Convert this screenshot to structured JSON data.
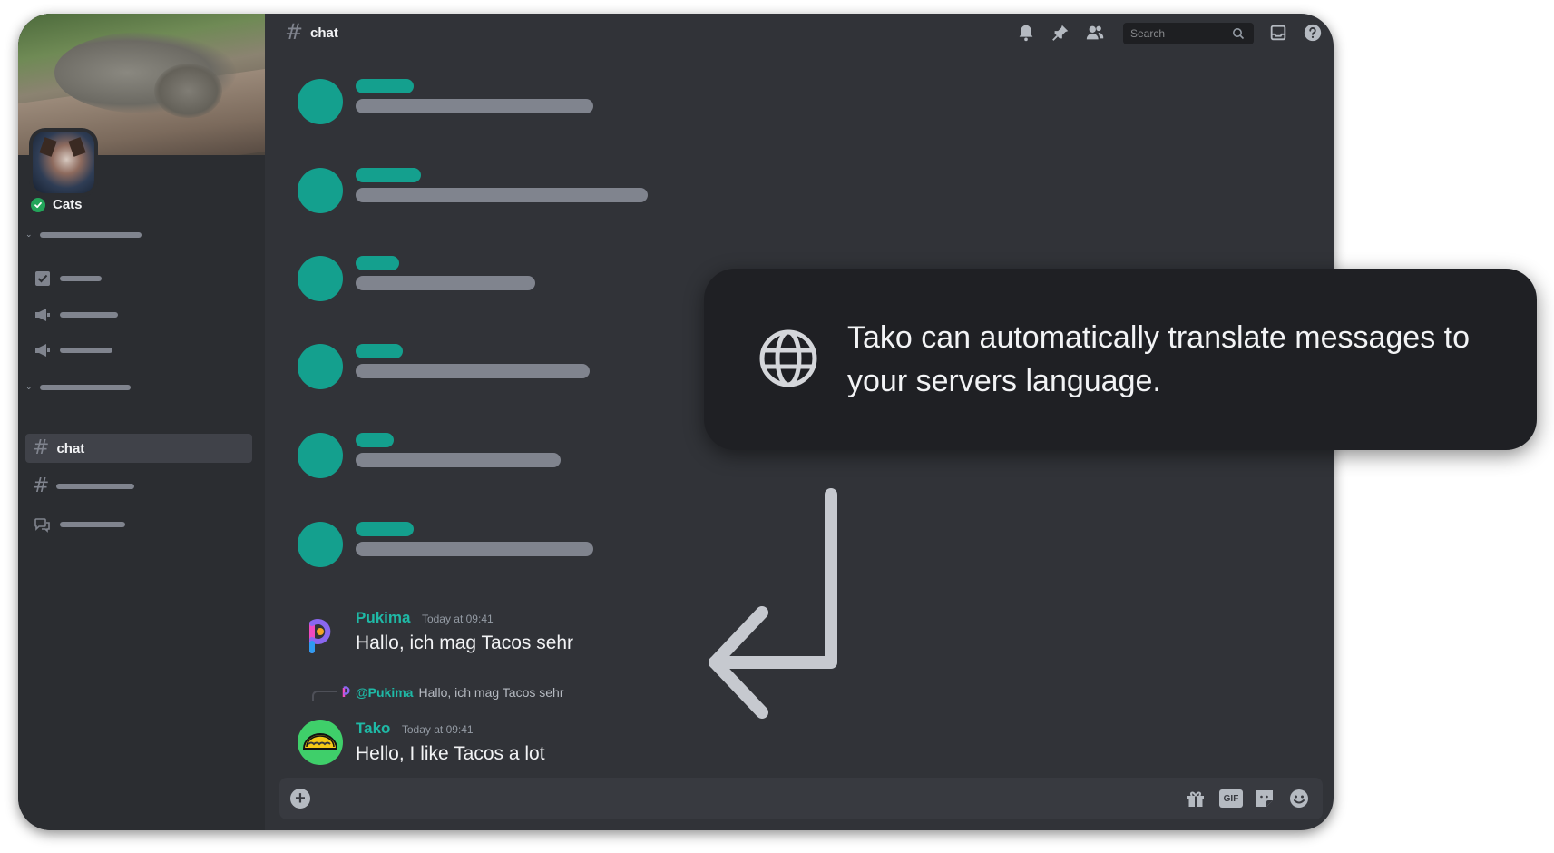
{
  "server": {
    "name": "Cats"
  },
  "sidebar": {
    "active_channel": "chat"
  },
  "header": {
    "channel_name": "chat",
    "search_placeholder": "Search"
  },
  "messages": [
    {
      "author": "Pukima",
      "timestamp": "Today at 09:41",
      "text": "Hallo, ich mag Tacos sehr"
    },
    {
      "reply_to": "@Pukima",
      "reply_text": "Hallo, ich mag Tacos sehr",
      "author": "Tako",
      "timestamp": "Today at 09:41",
      "text": "Hello, I like Tacos a lot"
    }
  ],
  "composer": {
    "gif_label": "GIF"
  },
  "tooltip": {
    "text": "Tako can automatically translate messages to your servers language."
  },
  "colors": {
    "accent": "#14a08e",
    "username": "#1fb9a6",
    "background": "#313338",
    "sidebar": "#2b2d31",
    "tooltip": "#1f2024"
  },
  "icons": [
    "bell-icon",
    "pin-icon",
    "members-icon",
    "search-icon",
    "inbox-icon",
    "help-icon",
    "checklist-icon",
    "megaphone-icon",
    "hash-icon",
    "forum-icon",
    "plus-icon",
    "gift-icon",
    "gif-icon",
    "sticker-icon",
    "emoji-icon",
    "globe-icon",
    "verified-icon"
  ]
}
